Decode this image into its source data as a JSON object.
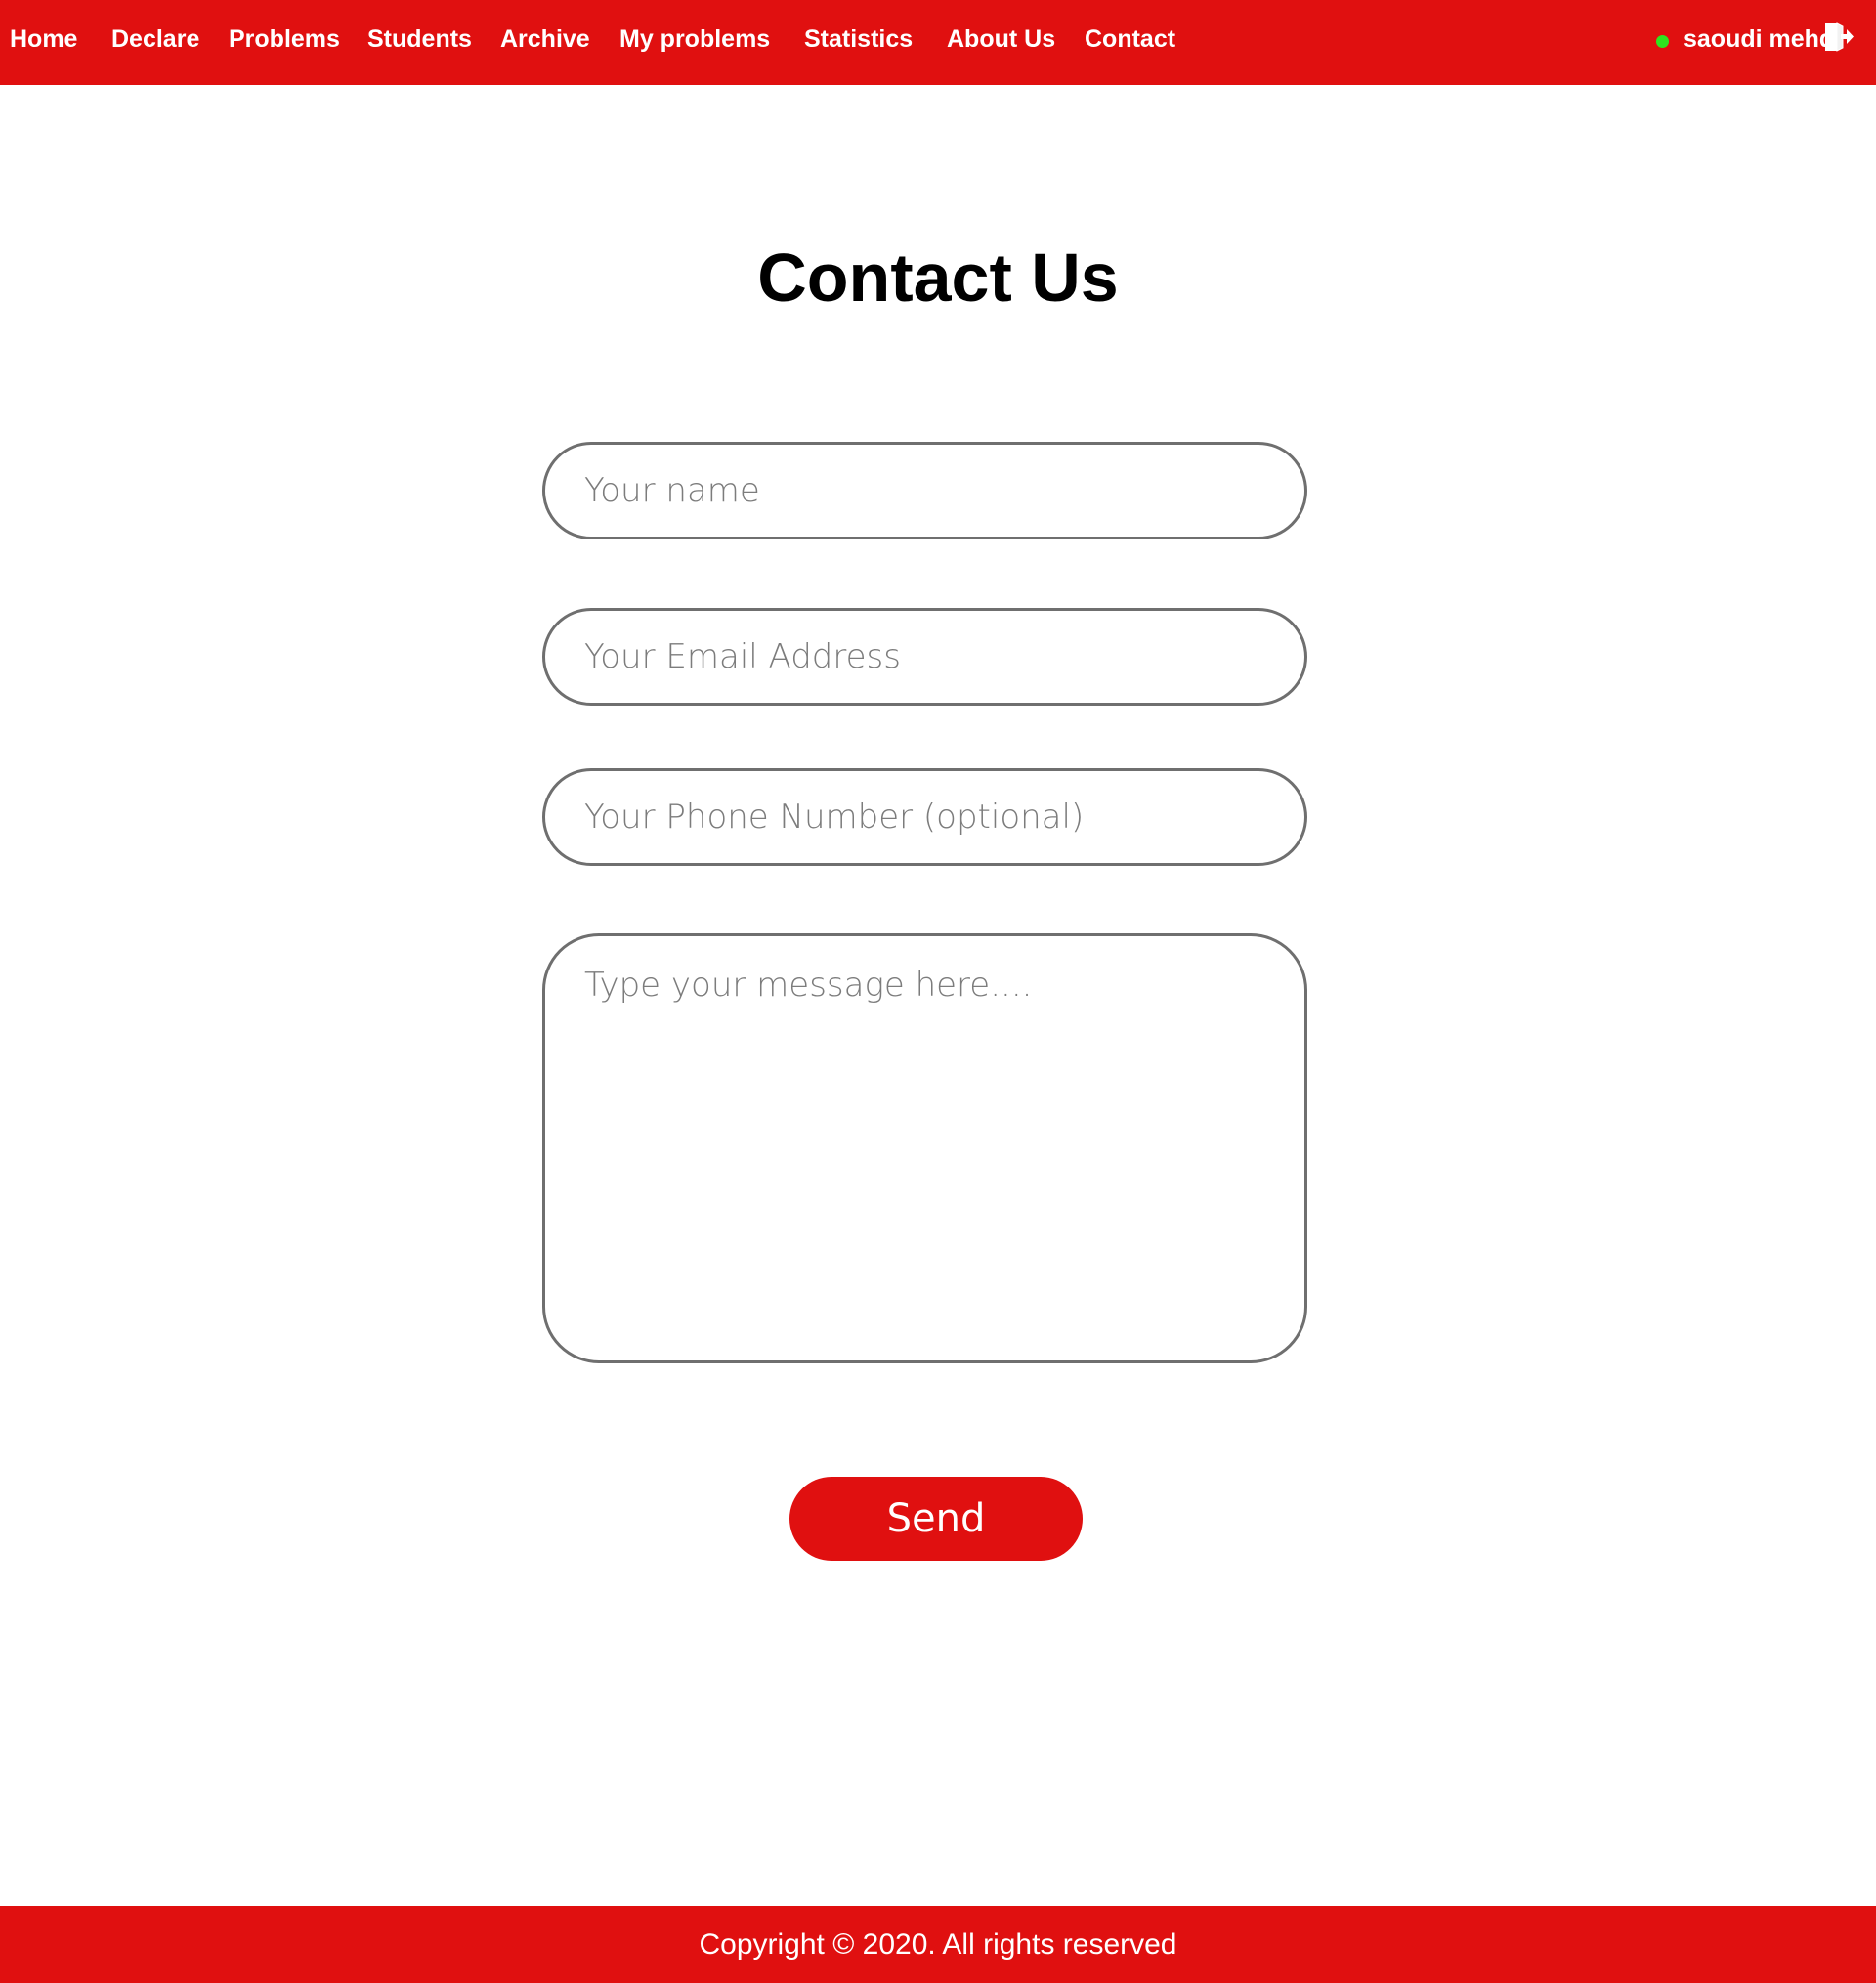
{
  "colors": {
    "accent": "#e01010",
    "online_indicator": "#2ee51e",
    "field_border": "#6f6f6f",
    "placeholder_text": "#7c7c7c"
  },
  "nav": {
    "items": [
      {
        "label": "Home"
      },
      {
        "label": "Declare"
      },
      {
        "label": "Problems"
      },
      {
        "label": "Students"
      },
      {
        "label": "Archive"
      },
      {
        "label": "My problems"
      },
      {
        "label": "Statistics"
      },
      {
        "label": "About Us"
      },
      {
        "label": "Contact"
      }
    ]
  },
  "user": {
    "name": "saoudi mehdi",
    "status_icon": "online-dot-icon",
    "logout_icon": "logout-icon"
  },
  "page": {
    "title": "Contact Us"
  },
  "form": {
    "name_placeholder": "Your name",
    "email_placeholder": "Your Email Address",
    "phone_placeholder": "Your Phone Number (optional)",
    "message_placeholder": "Type your message here....",
    "send_label": "Send"
  },
  "footer": {
    "copyright": "Copyright © 2020. All rights reserved"
  }
}
